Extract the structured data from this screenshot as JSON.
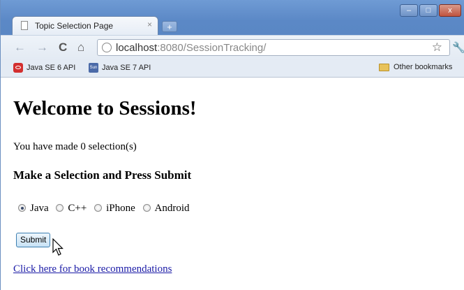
{
  "browser": {
    "tab_title": "Topic Selection Page",
    "tab_close": "×",
    "new_tab": "+",
    "window_buttons": {
      "minimize": "–",
      "maximize": "□",
      "close": "x"
    },
    "url_host": "localhost",
    "url_rest": ":8080/SessionTracking/",
    "bookmarks": [
      {
        "label": "Java SE 6 API",
        "icon": "java-se6-icon"
      },
      {
        "label": "Java SE 7 API",
        "icon": "java-se7-icon"
      }
    ],
    "other_bookmarks": "Other bookmarks",
    "java7_icon_text": "Sun"
  },
  "page": {
    "heading": "Welcome to Sessions!",
    "selection_count": "You have made 0 selection(s)",
    "subheading": "Make a Selection and Press Submit",
    "options": [
      "Java",
      "C++",
      "iPhone",
      "Android"
    ],
    "selected_option": "Java",
    "submit_label": "Submit",
    "link_text": "Click here for book recommendations"
  }
}
